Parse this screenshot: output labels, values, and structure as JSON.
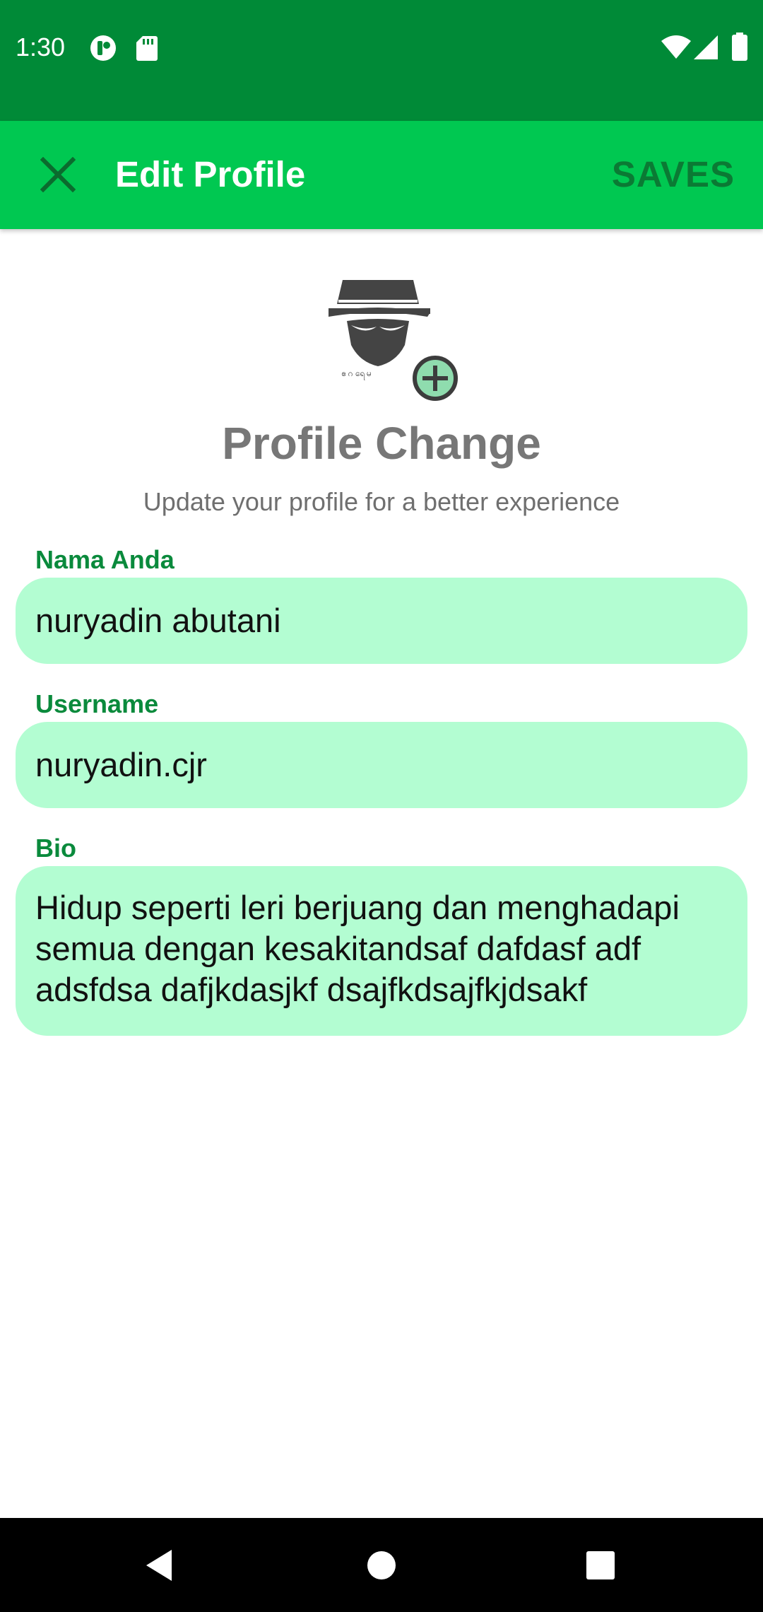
{
  "status_bar": {
    "time": "1:30",
    "background": "#008a37",
    "icons": [
      "notification-app-icon",
      "sd-card-icon",
      "wifi-icon",
      "cellular-signal-icon",
      "battery-icon"
    ]
  },
  "app_bar": {
    "title": "Edit Profile",
    "save_label": "SAVES",
    "close_icon": "close-icon",
    "background": "#00c851"
  },
  "avatar": {
    "icon": "incognito-hat-avatar",
    "add_icon": "add-circle-icon"
  },
  "header": {
    "title": "Profile Change",
    "subtitle": "Update your profile for a better experience"
  },
  "form": {
    "name": {
      "label": "Nama Anda",
      "value": "nuryadin abutani"
    },
    "username": {
      "label": "Username",
      "value": "nuryadin.cjr"
    },
    "bio": {
      "label": "Bio",
      "value": "Hidup seperti leri berjuang dan menghadapi semua dengan kesakitandsaf dafdasf adf adsfdsa dafjkdasjkf dsajfkdsajfkjdsakf"
    },
    "field_background": "#b3fdd2",
    "label_color": "#0a8a3c"
  },
  "nav_bar": {
    "icons": [
      "back-icon",
      "home-icon",
      "recents-icon"
    ]
  }
}
